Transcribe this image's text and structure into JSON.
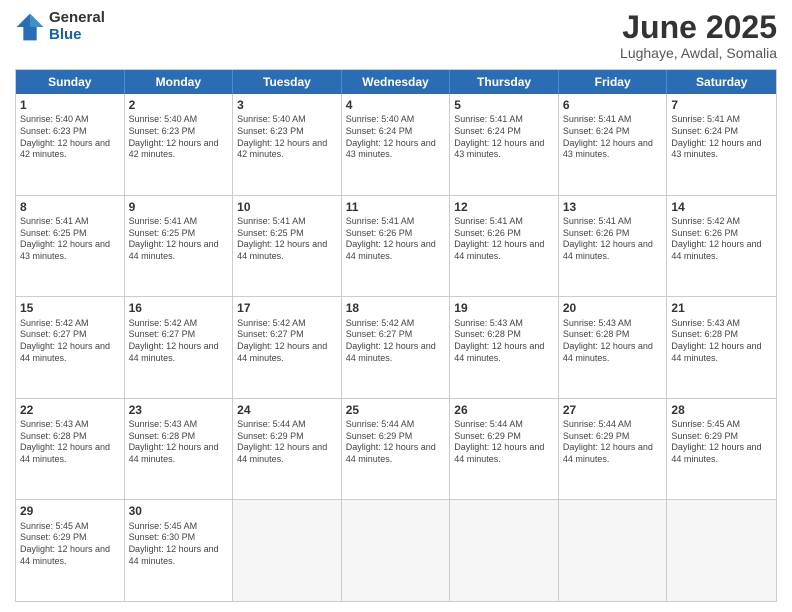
{
  "logo": {
    "general": "General",
    "blue": "Blue"
  },
  "title": "June 2025",
  "subtitle": "Lughaye, Awdal, Somalia",
  "header_days": [
    "Sunday",
    "Monday",
    "Tuesday",
    "Wednesday",
    "Thursday",
    "Friday",
    "Saturday"
  ],
  "weeks": [
    [
      {
        "day": "1",
        "sunrise": "Sunrise: 5:40 AM",
        "sunset": "Sunset: 6:23 PM",
        "daylight": "Daylight: 12 hours and 42 minutes."
      },
      {
        "day": "2",
        "sunrise": "Sunrise: 5:40 AM",
        "sunset": "Sunset: 6:23 PM",
        "daylight": "Daylight: 12 hours and 42 minutes."
      },
      {
        "day": "3",
        "sunrise": "Sunrise: 5:40 AM",
        "sunset": "Sunset: 6:23 PM",
        "daylight": "Daylight: 12 hours and 42 minutes."
      },
      {
        "day": "4",
        "sunrise": "Sunrise: 5:40 AM",
        "sunset": "Sunset: 6:24 PM",
        "daylight": "Daylight: 12 hours and 43 minutes."
      },
      {
        "day": "5",
        "sunrise": "Sunrise: 5:41 AM",
        "sunset": "Sunset: 6:24 PM",
        "daylight": "Daylight: 12 hours and 43 minutes."
      },
      {
        "day": "6",
        "sunrise": "Sunrise: 5:41 AM",
        "sunset": "Sunset: 6:24 PM",
        "daylight": "Daylight: 12 hours and 43 minutes."
      },
      {
        "day": "7",
        "sunrise": "Sunrise: 5:41 AM",
        "sunset": "Sunset: 6:24 PM",
        "daylight": "Daylight: 12 hours and 43 minutes."
      }
    ],
    [
      {
        "day": "8",
        "sunrise": "Sunrise: 5:41 AM",
        "sunset": "Sunset: 6:25 PM",
        "daylight": "Daylight: 12 hours and 43 minutes."
      },
      {
        "day": "9",
        "sunrise": "Sunrise: 5:41 AM",
        "sunset": "Sunset: 6:25 PM",
        "daylight": "Daylight: 12 hours and 44 minutes."
      },
      {
        "day": "10",
        "sunrise": "Sunrise: 5:41 AM",
        "sunset": "Sunset: 6:25 PM",
        "daylight": "Daylight: 12 hours and 44 minutes."
      },
      {
        "day": "11",
        "sunrise": "Sunrise: 5:41 AM",
        "sunset": "Sunset: 6:26 PM",
        "daylight": "Daylight: 12 hours and 44 minutes."
      },
      {
        "day": "12",
        "sunrise": "Sunrise: 5:41 AM",
        "sunset": "Sunset: 6:26 PM",
        "daylight": "Daylight: 12 hours and 44 minutes."
      },
      {
        "day": "13",
        "sunrise": "Sunrise: 5:41 AM",
        "sunset": "Sunset: 6:26 PM",
        "daylight": "Daylight: 12 hours and 44 minutes."
      },
      {
        "day": "14",
        "sunrise": "Sunrise: 5:42 AM",
        "sunset": "Sunset: 6:26 PM",
        "daylight": "Daylight: 12 hours and 44 minutes."
      }
    ],
    [
      {
        "day": "15",
        "sunrise": "Sunrise: 5:42 AM",
        "sunset": "Sunset: 6:27 PM",
        "daylight": "Daylight: 12 hours and 44 minutes."
      },
      {
        "day": "16",
        "sunrise": "Sunrise: 5:42 AM",
        "sunset": "Sunset: 6:27 PM",
        "daylight": "Daylight: 12 hours and 44 minutes."
      },
      {
        "day": "17",
        "sunrise": "Sunrise: 5:42 AM",
        "sunset": "Sunset: 6:27 PM",
        "daylight": "Daylight: 12 hours and 44 minutes."
      },
      {
        "day": "18",
        "sunrise": "Sunrise: 5:42 AM",
        "sunset": "Sunset: 6:27 PM",
        "daylight": "Daylight: 12 hours and 44 minutes."
      },
      {
        "day": "19",
        "sunrise": "Sunrise: 5:43 AM",
        "sunset": "Sunset: 6:28 PM",
        "daylight": "Daylight: 12 hours and 44 minutes."
      },
      {
        "day": "20",
        "sunrise": "Sunrise: 5:43 AM",
        "sunset": "Sunset: 6:28 PM",
        "daylight": "Daylight: 12 hours and 44 minutes."
      },
      {
        "day": "21",
        "sunrise": "Sunrise: 5:43 AM",
        "sunset": "Sunset: 6:28 PM",
        "daylight": "Daylight: 12 hours and 44 minutes."
      }
    ],
    [
      {
        "day": "22",
        "sunrise": "Sunrise: 5:43 AM",
        "sunset": "Sunset: 6:28 PM",
        "daylight": "Daylight: 12 hours and 44 minutes."
      },
      {
        "day": "23",
        "sunrise": "Sunrise: 5:43 AM",
        "sunset": "Sunset: 6:28 PM",
        "daylight": "Daylight: 12 hours and 44 minutes."
      },
      {
        "day": "24",
        "sunrise": "Sunrise: 5:44 AM",
        "sunset": "Sunset: 6:29 PM",
        "daylight": "Daylight: 12 hours and 44 minutes."
      },
      {
        "day": "25",
        "sunrise": "Sunrise: 5:44 AM",
        "sunset": "Sunset: 6:29 PM",
        "daylight": "Daylight: 12 hours and 44 minutes."
      },
      {
        "day": "26",
        "sunrise": "Sunrise: 5:44 AM",
        "sunset": "Sunset: 6:29 PM",
        "daylight": "Daylight: 12 hours and 44 minutes."
      },
      {
        "day": "27",
        "sunrise": "Sunrise: 5:44 AM",
        "sunset": "Sunset: 6:29 PM",
        "daylight": "Daylight: 12 hours and 44 minutes."
      },
      {
        "day": "28",
        "sunrise": "Sunrise: 5:45 AM",
        "sunset": "Sunset: 6:29 PM",
        "daylight": "Daylight: 12 hours and 44 minutes."
      }
    ],
    [
      {
        "day": "29",
        "sunrise": "Sunrise: 5:45 AM",
        "sunset": "Sunset: 6:29 PM",
        "daylight": "Daylight: 12 hours and 44 minutes."
      },
      {
        "day": "30",
        "sunrise": "Sunrise: 5:45 AM",
        "sunset": "Sunset: 6:30 PM",
        "daylight": "Daylight: 12 hours and 44 minutes."
      },
      {
        "day": "",
        "sunrise": "",
        "sunset": "",
        "daylight": ""
      },
      {
        "day": "",
        "sunrise": "",
        "sunset": "",
        "daylight": ""
      },
      {
        "day": "",
        "sunrise": "",
        "sunset": "",
        "daylight": ""
      },
      {
        "day": "",
        "sunrise": "",
        "sunset": "",
        "daylight": ""
      },
      {
        "day": "",
        "sunrise": "",
        "sunset": "",
        "daylight": ""
      }
    ]
  ]
}
